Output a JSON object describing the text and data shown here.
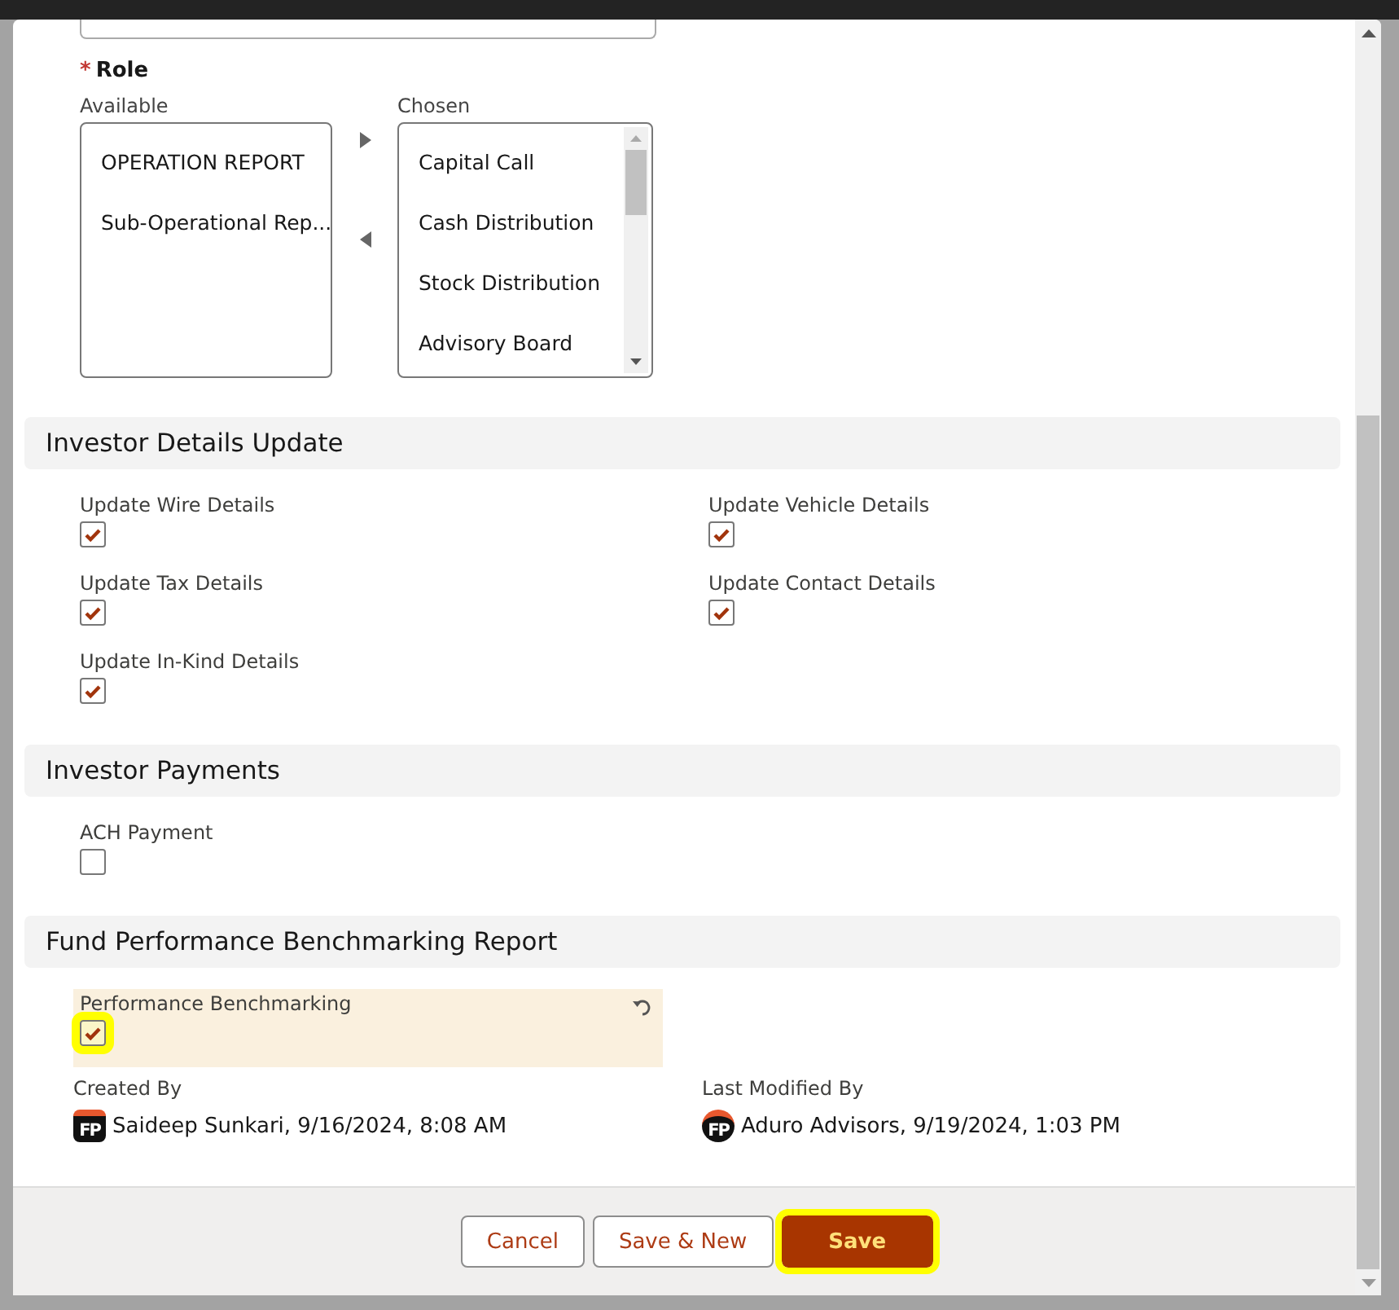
{
  "role": {
    "label": "Role",
    "required_mark": "*",
    "available_label": "Available",
    "available": [
      "OPERATION REPORT",
      "Sub-Operational Rep..."
    ],
    "chosen_label": "Chosen",
    "chosen": [
      "Capital Call",
      "Cash Distribution",
      "Stock Distribution",
      "Advisory Board"
    ]
  },
  "sections": [
    {
      "title": "Investor Details Update",
      "fields": [
        {
          "label": "Update Wire Details",
          "checked": true
        },
        {
          "label": "Update Vehicle Details",
          "checked": true
        },
        {
          "label": "Update Tax Details",
          "checked": true
        },
        {
          "label": "Update Contact Details",
          "checked": true
        },
        {
          "label": "Update In-Kind Details",
          "checked": true
        }
      ]
    },
    {
      "title": "Investor Payments",
      "fields": [
        {
          "label": "ACH Payment",
          "checked": false
        }
      ]
    },
    {
      "title": "Fund Performance Benchmarking Report",
      "fields": [
        {
          "label": "Performance Benchmarking",
          "checked": true,
          "edited": true,
          "highlighted": true
        }
      ]
    }
  ],
  "audit": [
    {
      "label": "Created By",
      "avatar": "FP",
      "name": "Saideep Sunkari",
      "date": ", 9/16/2024, 8:08 AM"
    },
    {
      "label": "Last Modified By",
      "avatar": "FP",
      "name": "Aduro Advisors",
      "date": ", 9/19/2024, 1:03 PM"
    }
  ],
  "buttons": [
    {
      "label": "Cancel",
      "kind": "neutral",
      "highlighted": false
    },
    {
      "label": "Save & New",
      "kind": "neutral",
      "highlighted": false
    },
    {
      "label": "Save",
      "kind": "brand",
      "highlighted": true
    }
  ]
}
